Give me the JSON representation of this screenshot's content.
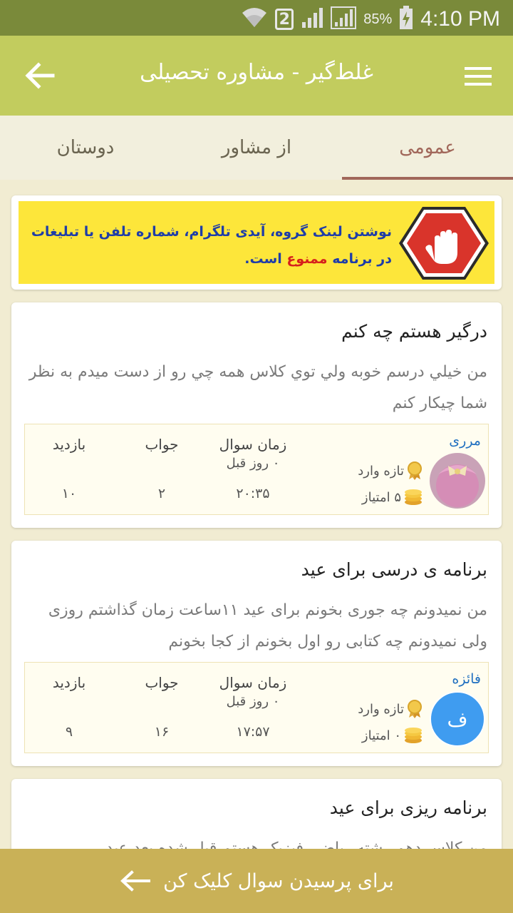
{
  "status": {
    "sim_slot": "2",
    "battery": "85%",
    "time": "4:10 PM"
  },
  "appbar": {
    "title": "غلط‌گیر - مشاوره تحصیلی",
    "back_icon": "arrow-left-icon",
    "menu_icon": "hamburger-menu-icon"
  },
  "tabs": [
    {
      "label": "عمومی",
      "active": true
    },
    {
      "label": "از مشاور",
      "active": false
    },
    {
      "label": "دوستان",
      "active": false
    }
  ],
  "banner": {
    "line1": "نوشتن لینک گروه، آیدی تلگرام، شماره تلفن یا تبلیغات",
    "line2_prefix": "در برنامه",
    "line2_red": "ممنوع",
    "line2_suffix": "است."
  },
  "stat_labels": {
    "time": "زمان سوال",
    "answers": "جواب",
    "views": "بازدید"
  },
  "posts": [
    {
      "title": "درگیر هستم  چه کنم",
      "body": "من خيلي درسم خوبه ولي توي كلاس همه چي رو از دست ميدم به نظر شما چيكار كنم",
      "user": "مرری",
      "rank": "تازه وارد",
      "score": "۵ امتیاز",
      "ago": "۰ روز قبل",
      "time": "۲۰:۳۵",
      "answers": "۲",
      "views": "۱۰"
    },
    {
      "title": "برنامه ی درسی برای عید",
      "body": "من نمیدونم چه جوری بخونم برای عید ۱۱ساعت زمان گذاشتم روزی  ولی نمیدونم چه کتابی رو اول بخونم از کجا بخونم",
      "user": "فائزه",
      "avatar_letter": "ف",
      "rank": "تازه وارد",
      "score": "۰ امتیاز",
      "ago": "۰ روز قبل",
      "time": "۱۷:۵۷",
      "answers": "۱۶",
      "views": "۹"
    },
    {
      "title": "برنامه ریزی برای عید",
      "body": "من کلاس دهم رشته ریاضی فیزیک هستم قبل شده بعد عید"
    }
  ],
  "bottom": {
    "label": "برای پرسیدن سوال کلیک کن",
    "icon": "arrow-left-icon"
  },
  "colors": {
    "appbar": "#c2cc5e",
    "statusbar": "#7a8a3a",
    "tab_active": "#a1675a",
    "bottom_bar": "#c9b157",
    "banner": "#fde63a"
  }
}
